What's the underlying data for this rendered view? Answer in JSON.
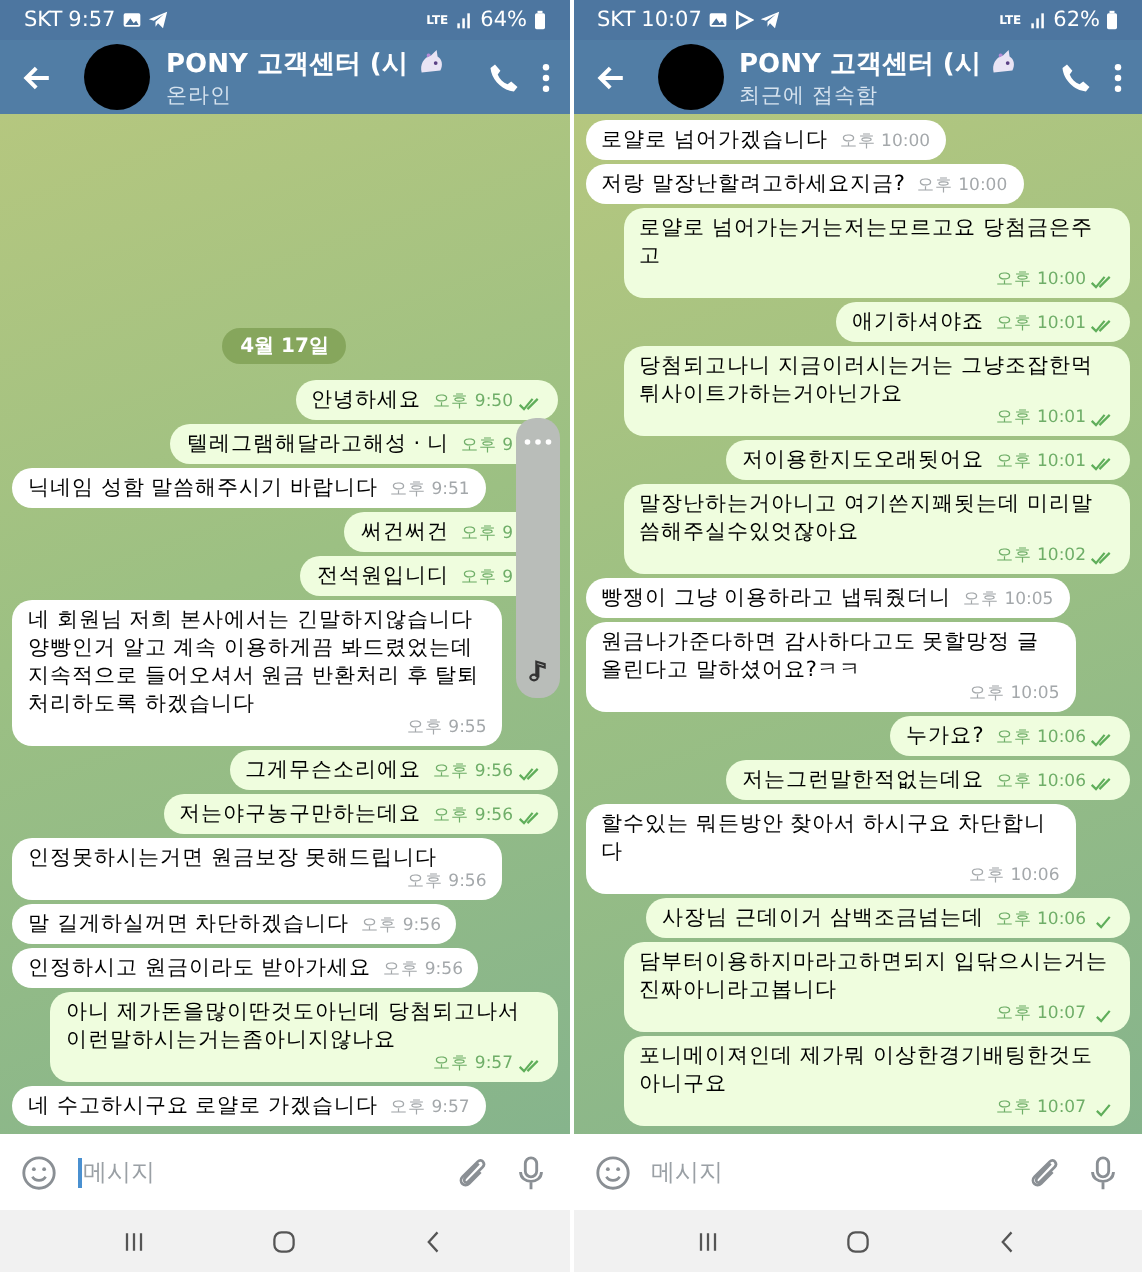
{
  "panes": [
    {
      "status_bar": {
        "carrier": "SKT",
        "time": "9:57",
        "network": "LTE",
        "battery": "64%",
        "icons": [
          {
            "kind": "image"
          },
          {
            "kind": "telegram"
          }
        ]
      },
      "header": {
        "title": "PONY 고객센터 (시",
        "subtitle": "온라인"
      },
      "date_chip": "4월 17일",
      "messages": [
        {
          "kind": "outgoing",
          "text": "안녕하세요",
          "time": "오후 9:50",
          "read": true
        },
        {
          "kind": "outgoing",
          "text": "텔레그램해달라고해성 · 니",
          "time": "오후 9"
        },
        {
          "kind": "incoming",
          "text": "닉네임 성함 말씀해주시기 바랍니다",
          "time": "오후 9:51"
        },
        {
          "kind": "outgoing",
          "text": "써건써건",
          "time": "오후 9"
        },
        {
          "kind": "outgoing",
          "text": "전석원입니디",
          "time": "오후 9"
        },
        {
          "kind": "incoming",
          "text": "네 회원님 저희 본사에서는 긴말하지않습니다 양빵인거 알고 계속 이용하게끔 봐드렸었는데 지속적으로 들어오셔서 원금 반환처리 후 탈퇴처리하도록 하겠습니다",
          "time": "오후 9:55"
        },
        {
          "kind": "outgoing",
          "text": "그게무슨소리에요",
          "time": "오후 9:56",
          "read": true
        },
        {
          "kind": "outgoing",
          "text": "저는야구농구만하는데요",
          "time": "오후 9:56",
          "read": true
        },
        {
          "kind": "incoming",
          "text": "인정못하시는거면 원금보장 못해드립니다",
          "time": "오후 9:56"
        },
        {
          "kind": "incoming",
          "text": "말 길게하실꺼면 차단하겠습니다",
          "time": "오후 9:56"
        },
        {
          "kind": "incoming",
          "text": "인정하시고 원금이라도 받아가세요",
          "time": "오후 9:56"
        },
        {
          "kind": "outgoing",
          "text": "아니 제가돈을많이딴것도아닌데 당첨되고나서 이런말하시는거는좀아니지않나요",
          "time": "오후 9:57",
          "read": true
        },
        {
          "kind": "incoming",
          "text": "네 수고하시구요 로얄로 가겠습니다",
          "time": "오후 9:57"
        }
      ],
      "overlay": {
        "kind": "floating-panel"
      },
      "input": {
        "placeholder": "메시지",
        "focused": true
      }
    },
    {
      "status_bar": {
        "carrier": "SKT",
        "time": "10:07",
        "network": "LTE",
        "battery": "62%",
        "icons": [
          {
            "kind": "image"
          },
          {
            "kind": "play"
          },
          {
            "kind": "telegram"
          }
        ]
      },
      "header": {
        "title": "PONY 고객센터 (시",
        "subtitle": "최근에 접속함"
      },
      "messages": [
        {
          "kind": "incoming",
          "text": "로얄로 넘어가겠습니다",
          "time": "오후 10:00"
        },
        {
          "kind": "incoming",
          "text": "저랑 말장난할려고하세요지금?",
          "time": "오후 10:00"
        },
        {
          "kind": "outgoing",
          "text": "로얄로 넘어가는거는저는모르고요 당첨금은주고",
          "time": "오후 10:00",
          "read": true
        },
        {
          "kind": "outgoing",
          "text": "애기하셔야죠",
          "time": "오후 10:01",
          "read": true
        },
        {
          "kind": "outgoing",
          "text": "당첨되고나니 지금이러시는거는 그냥조잡한먹튀사이트가하는거아닌가요",
          "time": "오후 10:01",
          "read": true
        },
        {
          "kind": "outgoing",
          "text": "저이용한지도오래됫어요",
          "time": "오후 10:01",
          "read": true
        },
        {
          "kind": "outgoing",
          "text": "말장난하는거아니고 여기쓴지꽤됫는데 미리말씀해주실수있엇잖아요",
          "time": "오후 10:02",
          "read": true
        },
        {
          "kind": "incoming",
          "text": "빵쟁이 그냥 이용하라고 냅둬줬더니",
          "time": "오후 10:05"
        },
        {
          "kind": "incoming",
          "text": "원금나가준다하면 감사하다고도 못할망정 글올린다고 말하셨어요?ㅋㅋ",
          "time": "오후 10:05"
        },
        {
          "kind": "outgoing",
          "text": "누가요?",
          "time": "오후 10:06",
          "read": true
        },
        {
          "kind": "outgoing",
          "text": "저는그런말한적없는데요",
          "time": "오후 10:06",
          "read": true
        },
        {
          "kind": "incoming",
          "text": "할수있는 뭐든방안 찾아서 하시구요 차단합니다",
          "time": "오후 10:06"
        },
        {
          "kind": "outgoing",
          "text": "사장님 근데이거 삼백조금넘는데",
          "time": "오후 10:06",
          "read": false
        },
        {
          "kind": "outgoing",
          "text": "담부터이용하지마라고하면되지 입닦으시는거는 진짜아니라고봅니다",
          "time": "오후 10:07",
          "read": false
        },
        {
          "kind": "outgoing",
          "text": "포니메이져인데 제가뭐 이상한경기배팅한것도 아니구요",
          "time": "오후 10:07",
          "read": false
        }
      ],
      "input": {
        "placeholder": "메시지",
        "focused": false
      }
    }
  ]
}
